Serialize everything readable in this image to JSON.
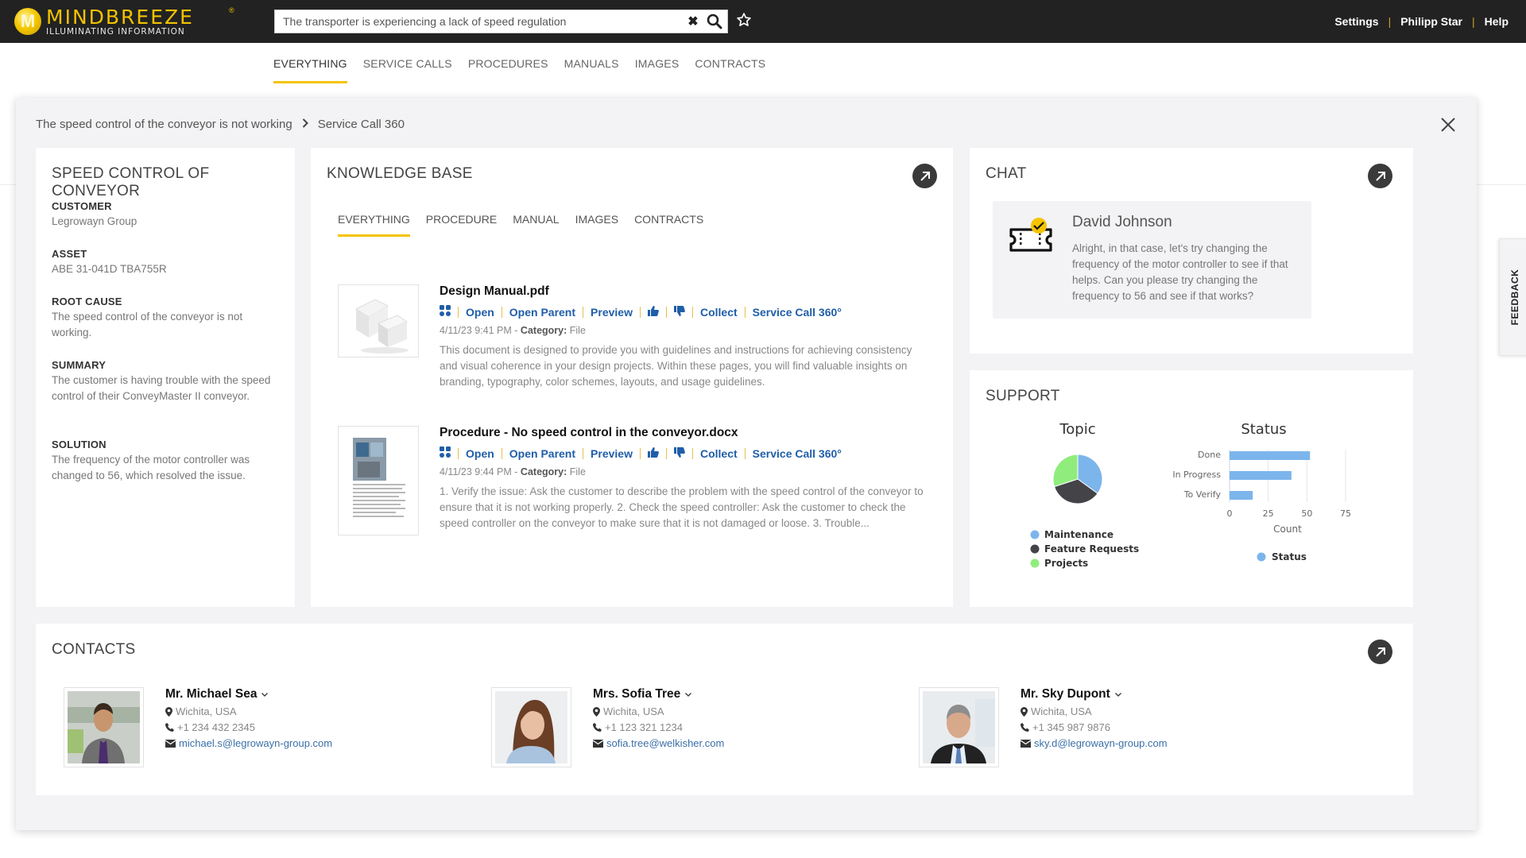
{
  "header": {
    "logo_name": "MINDBREEZE",
    "logo_tagline": "ILLUMINATING INFORMATION",
    "logo_registered": "®",
    "search": {
      "value": "The transporter is experiencing a lack of speed regulation",
      "placeholder": "",
      "clear_icon": "times-icon",
      "search_icon": "magnifier-icon"
    },
    "favorite_icon": "star-outline-icon",
    "links": [
      "Settings",
      "Philipp Star",
      "Help"
    ]
  },
  "main_tabs": [
    {
      "label": "EVERYTHING",
      "active": true
    },
    {
      "label": "SERVICE CALLS",
      "active": false
    },
    {
      "label": "PROCEDURES",
      "active": false
    },
    {
      "label": "MANUALS",
      "active": false
    },
    {
      "label": "IMAGES",
      "active": false
    },
    {
      "label": "CONTRACTS",
      "active": false
    }
  ],
  "breadcrumb": {
    "items": [
      "The speed control of the conveyor is not working",
      "Service Call 360"
    ]
  },
  "info_card": {
    "title": "SPEED CONTROL OF CONVEYOR",
    "fields": [
      {
        "label": "CUSTOMER",
        "value": "Legrowayn Group"
      },
      {
        "label": "ASSET",
        "value": "ABE 31-041D TBA755R"
      },
      {
        "label": "ROOT CAUSE",
        "value": "The speed control of the conveyor is not working."
      },
      {
        "label": "SUMMARY",
        "value": "The customer is having trouble with the speed control of their ConveyMaster II conveyor."
      },
      {
        "label": "SOLUTION",
        "value": "The frequency of the motor controller was changed to 56, which resolved the issue."
      }
    ]
  },
  "knowledge_base": {
    "title": "KNOWLEDGE BASE",
    "tabs": [
      {
        "label": "EVERYTHING",
        "active": true
      },
      {
        "label": "PROCEDURE",
        "active": false
      },
      {
        "label": "MANUAL",
        "active": false
      },
      {
        "label": "IMAGES",
        "active": false
      },
      {
        "label": "CONTRACTS",
        "active": false
      }
    ],
    "actions": {
      "open": "Open",
      "open_parent": "Open Parent",
      "preview": "Preview",
      "collect": "Collect",
      "service_call": "Service Call 360°"
    },
    "category_label": "Category:",
    "results": [
      {
        "title": "Design Manual.pdf",
        "date": "4/11/23 9:41 PM",
        "category": "File",
        "thumbnail": "boxes-image",
        "description": "This document is designed to provide you with guidelines and instructions for achieving consistency and visual coherence in your design projects. Within these pages, you will find valuable insights on branding, typography, color schemes, layouts, and usage guidelines."
      },
      {
        "title": "Procedure - No speed control in the conveyor.docx",
        "date": "4/11/23 9:44 PM",
        "category": "File",
        "thumbnail": "document-page-image",
        "description": "1. Verify the issue: Ask the customer to describe the problem with the speed control of the conveyor to ensure that it is not working properly. 2. Check the speed controller: Ask the customer to check the speed controller on the conveyor to make sure that it is not damaged or loose. 3. Trouble..."
      }
    ]
  },
  "chat": {
    "title": "CHAT",
    "message": {
      "author": "David Johnson",
      "icon": "ticket-check-icon",
      "text": "Alright, in that case, let's try changing the frequency of the motor controller to see if that helps. Can you please try changing the frequency to 56 and see if that works?"
    }
  },
  "support": {
    "title": "SUPPORT"
  },
  "chart_data": [
    {
      "type": "pie",
      "title": "Topic",
      "categories": [
        "Maintenance",
        "Feature Requests",
        "Projects"
      ],
      "values": [
        35,
        35,
        30
      ],
      "colors": [
        "#7cb5ec",
        "#434348",
        "#90ed7d"
      ],
      "legend": "bottom"
    },
    {
      "type": "bar",
      "orientation": "horizontal",
      "title": "Status",
      "categories": [
        "Done",
        "In Progress",
        "To Verify"
      ],
      "series": [
        {
          "name": "Status",
          "values": [
            52,
            40,
            15
          ],
          "color": "#7cb5ec"
        }
      ],
      "xlabel": "Count",
      "ylabel": "",
      "xlim": [
        0,
        75
      ],
      "xticks": [
        0,
        25,
        50,
        75
      ],
      "grid": true,
      "legend": "bottom"
    }
  ],
  "contacts": {
    "title": "CONTACTS",
    "people": [
      {
        "name": "Mr. Michael Sea",
        "location": "Wichita, USA",
        "phone": "+1 234 432 2345",
        "email": "michael.s@legrowayn-group.com",
        "photo": "man-portrait-photo"
      },
      {
        "name": "Mrs. Sofia Tree",
        "location": "Wichita, USA",
        "phone": "+1 123 321 1234",
        "email": "sofia.tree@welkisher.com",
        "photo": "woman-portrait-photo"
      },
      {
        "name": "Mr. Sky Dupont",
        "location": "Wichita, USA",
        "phone": "+1 345 987 9876",
        "email": "sky.d@legrowayn-group.com",
        "photo": "man-portrait-photo"
      }
    ]
  },
  "feedback": {
    "label": "FEEDBACK"
  },
  "colors": {
    "accent": "#f5c400",
    "header_bg": "#222222",
    "link": "#1f5ea8",
    "modal_bg": "#f3f2f4"
  }
}
